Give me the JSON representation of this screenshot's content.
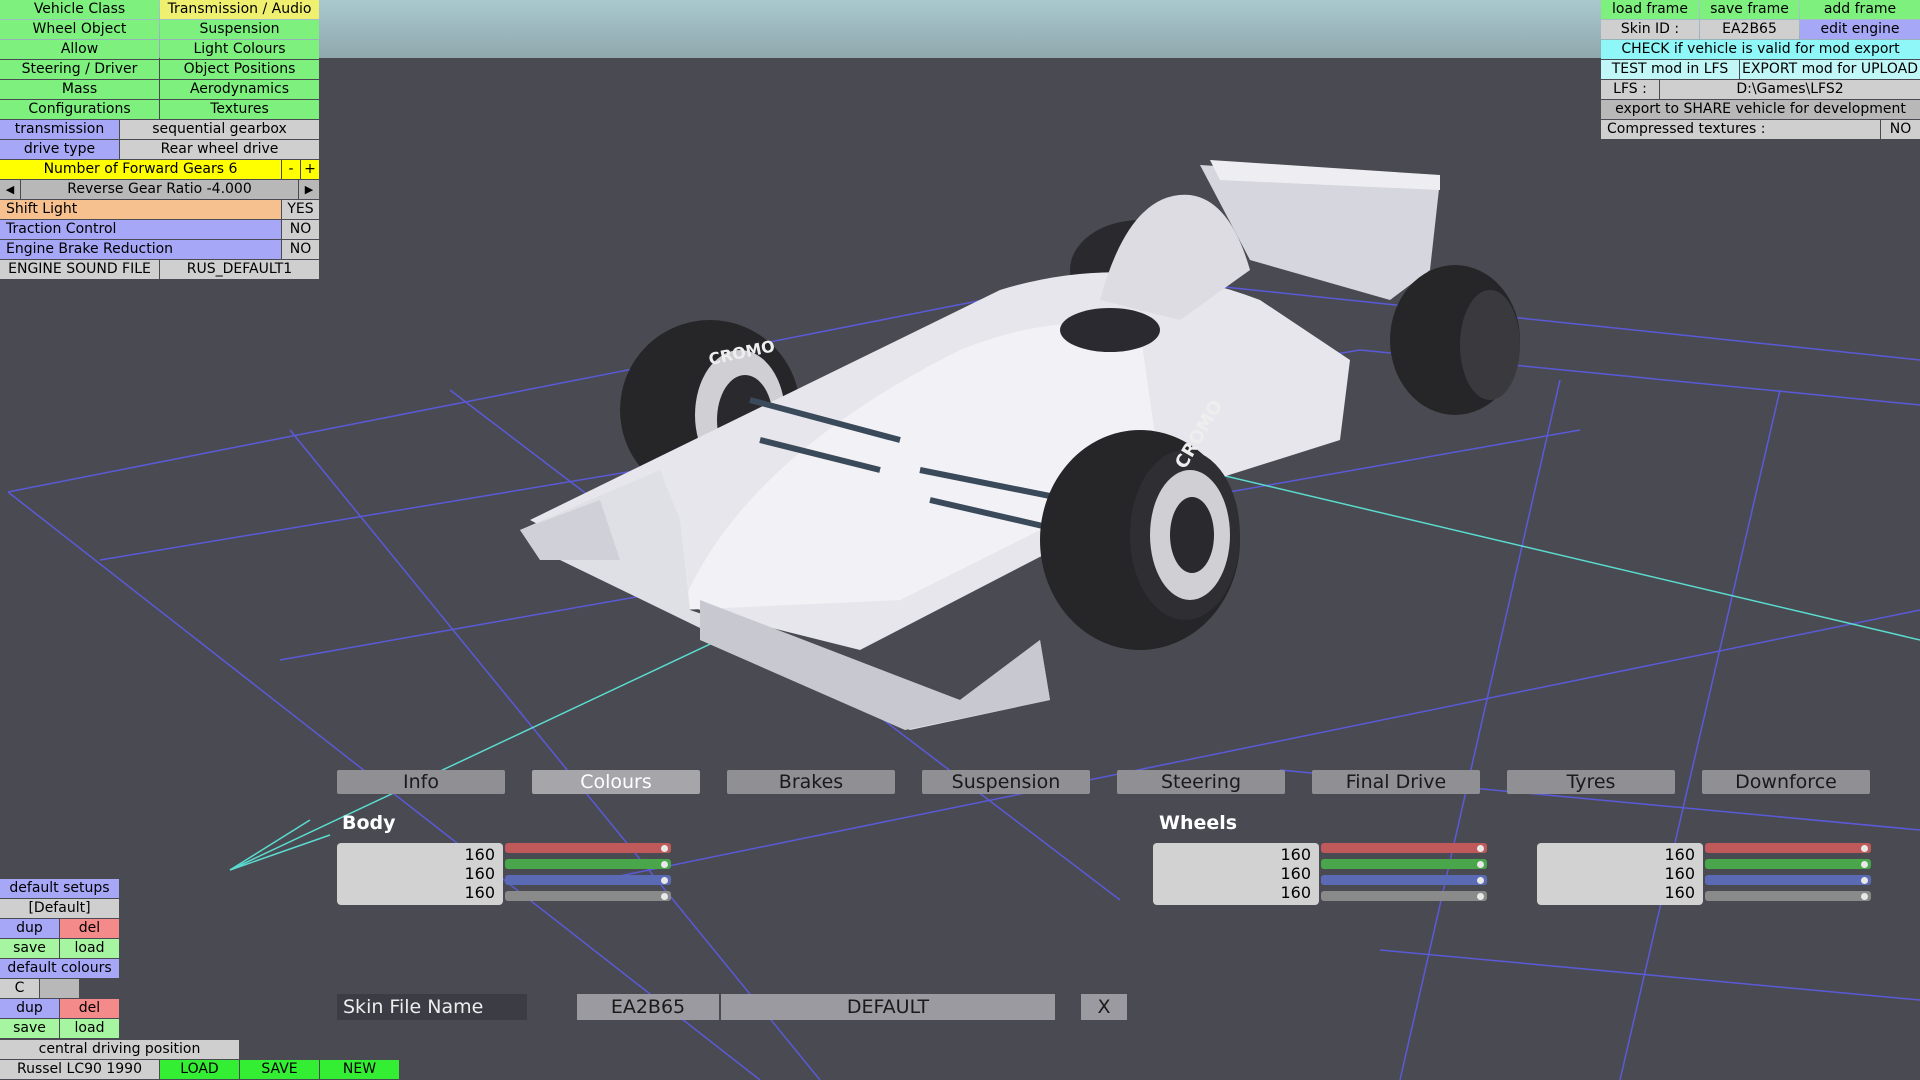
{
  "left_menu": {
    "tabs": [
      [
        "Vehicle Class",
        "Transmission / Audio"
      ],
      [
        "Wheel Object",
        "Suspension"
      ],
      [
        "Allow",
        "Light Colours"
      ],
      [
        "Steering / Driver",
        "Object Positions"
      ],
      [
        "Mass",
        "Aerodynamics"
      ],
      [
        "Configurations",
        "Textures"
      ]
    ],
    "transmission_label": "transmission",
    "transmission_value": "sequential gearbox",
    "drive_type_label": "drive type",
    "drive_type_value": "Rear wheel drive",
    "forward_gears": "Number of Forward Gears 6",
    "minus": "-",
    "plus": "+",
    "left_arrow": "◀",
    "right_arrow": "▶",
    "reverse_ratio": "Reverse Gear Ratio -4.000",
    "shift_light_label": "Shift Light",
    "shift_light_value": "YES",
    "traction_label": "Traction Control",
    "traction_value": "NO",
    "brake_red_label": "Engine Brake Reduction",
    "brake_red_value": "NO",
    "sound_label": "ENGINE SOUND FILE",
    "sound_value": "RUS_DEFAULT1"
  },
  "right_menu": {
    "load_frame": "load frame",
    "save_frame": "save frame",
    "add_frame": "add frame",
    "skin_id_label": "Skin ID :",
    "skin_id_value": "EA2B65",
    "edit_engine": "edit engine",
    "check_valid": "CHECK if vehicle is valid for mod export",
    "test_mod": "TEST mod in LFS",
    "export_mod": "EXPORT mod for UPLOAD",
    "lfs_label": "LFS :",
    "lfs_path": "D:\\Games\\LFS2",
    "export_share": "export to SHARE vehicle for development",
    "compressed_label": "Compressed textures :",
    "compressed_value": "NO"
  },
  "bottom_tabs": [
    "Info",
    "Colours",
    "Brakes",
    "Suspension",
    "Steering",
    "Final Drive",
    "Tyres",
    "Downforce"
  ],
  "colours": {
    "body_title": "Body",
    "wheels_title": "Wheels",
    "values": [
      "160",
      "160",
      "160"
    ],
    "slider_colors": [
      "#c05a5a",
      "#4aa64a",
      "#5a6ab4",
      "#8a8a8a"
    ],
    "slider_levels": [
      1.0,
      1.0,
      1.0,
      1.0
    ]
  },
  "skin": {
    "label": "Skin File Name",
    "id": "EA2B65",
    "name": "DEFAULT",
    "close": "X"
  },
  "bottom_left": {
    "default_setups": "default setups",
    "default_item": "[Default]",
    "dup": "dup",
    "del": "del",
    "save": "save",
    "load": "load",
    "default_colours": "default colours",
    "c_label": "C",
    "central": "central driving position",
    "vehicle_name": "Russel LC90 1990",
    "load_btn": "LOAD",
    "save_btn": "SAVE",
    "new_btn": "NEW"
  },
  "car": {
    "tyre_brand": "CROMO"
  }
}
